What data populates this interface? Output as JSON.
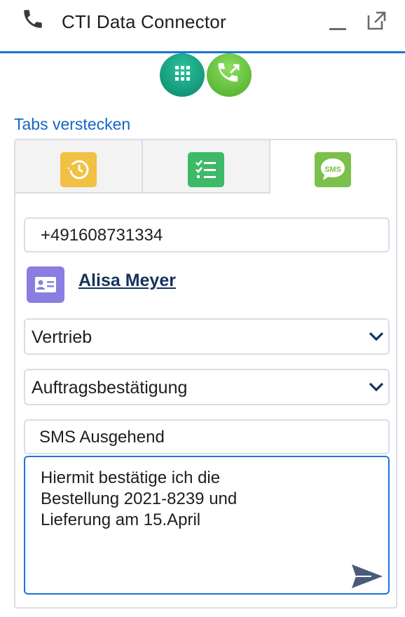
{
  "header": {
    "title": "CTI Data Connector",
    "icons": {
      "phone": "phone-icon",
      "minimize": "minimize-icon",
      "popout": "popout-icon"
    }
  },
  "top_buttons": {
    "dialpad": "dialpad-icon",
    "call": "call-transfer-icon"
  },
  "hide_tabs_label": "Tabs verstecken",
  "tabs": [
    {
      "name": "history",
      "icon": "history-icon",
      "active": false
    },
    {
      "name": "tasks",
      "icon": "task-list-icon",
      "active": false
    },
    {
      "name": "sms",
      "icon": "sms-icon",
      "label": "SMS",
      "active": true
    }
  ],
  "form": {
    "phone_number": "+491608731334",
    "contact_name": "Alisa Meyer",
    "department_selected": "Vertrieb",
    "template_selected": "Auftragsbestätigung",
    "subject": "SMS Ausgehend",
    "message_lines": [
      "Hiermit bestätige ich die",
      "Bestellung 2021-8239 und",
      "Lieferung am 15.April"
    ]
  },
  "colors": {
    "accent": "#1b74d8",
    "link": "#1466c7",
    "history_tab": "#f2c043",
    "tasks_tab": "#3cba68",
    "sms_tab": "#7ac04b",
    "contact_icon": "#8a7ee0",
    "dialpad": "#14987a",
    "call": "#5dbb36"
  }
}
